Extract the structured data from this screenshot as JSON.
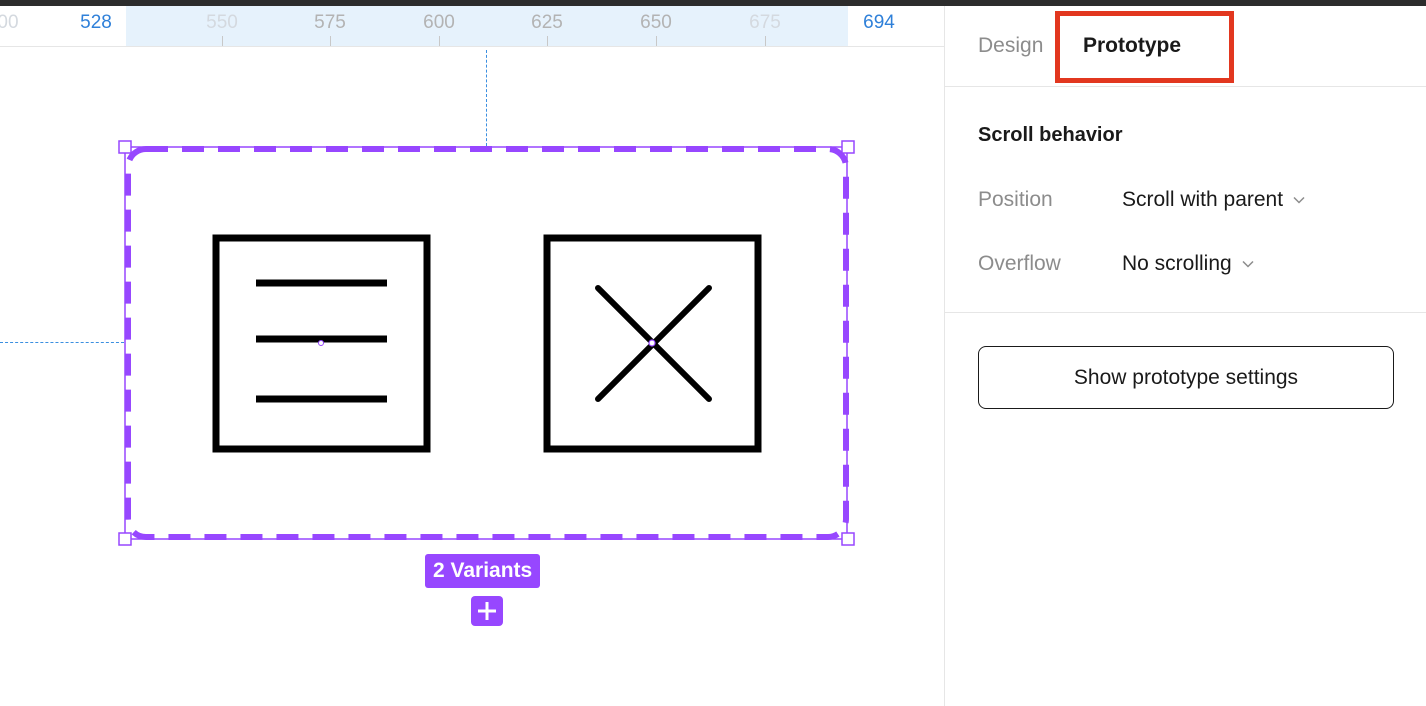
{
  "ruler": {
    "ticks": [
      {
        "label": "00",
        "style": "faint"
      },
      {
        "label": "528",
        "style": "edge"
      },
      {
        "label": "550",
        "style": "faint"
      },
      {
        "label": "575",
        "style": "normal"
      },
      {
        "label": "600",
        "style": "normal"
      },
      {
        "label": "625",
        "style": "normal"
      },
      {
        "label": "650",
        "style": "normal"
      },
      {
        "label": "675",
        "style": "faint"
      },
      {
        "label": "694",
        "style": "edge"
      }
    ]
  },
  "canvas": {
    "selection_color": "#9747ff",
    "guide_color": "#3b8fe0",
    "variants": [
      {
        "icon": "hamburger-menu-icon"
      },
      {
        "icon": "close-x-icon"
      }
    ],
    "variants_badge": "2 Variants",
    "add_variant_icon": "plus-icon"
  },
  "panel": {
    "tabs": {
      "design": "Design",
      "prototype": "Prototype",
      "active": "prototype",
      "highlight_color": "#e2371f"
    },
    "scroll_behavior": {
      "title": "Scroll behavior",
      "position_label": "Position",
      "position_value": "Scroll with parent",
      "overflow_label": "Overflow",
      "overflow_value": "No scrolling"
    },
    "settings_button": "Show prototype settings"
  }
}
